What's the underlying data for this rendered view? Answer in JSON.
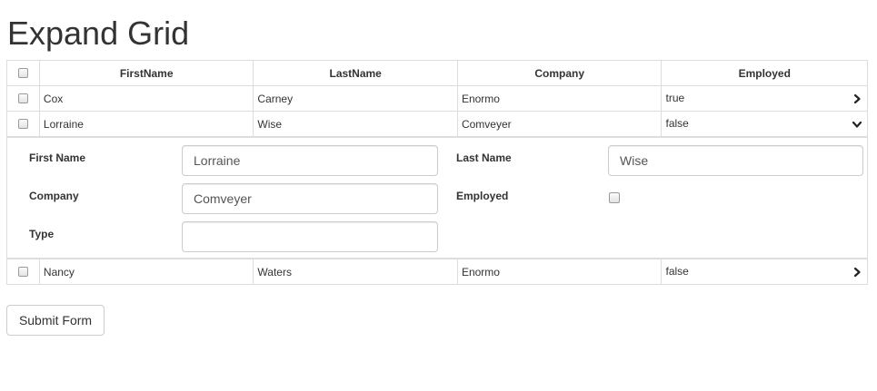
{
  "page": {
    "title": "Expand Grid"
  },
  "grid": {
    "columns": [
      "FirstName",
      "LastName",
      "Company",
      "Employed"
    ],
    "rows": [
      {
        "first": "Cox",
        "last": "Carney",
        "company": "Enormo",
        "employed": "true",
        "expander": "chevron-right-icon"
      },
      {
        "first": "Lorraine",
        "last": "Wise",
        "company": "Comveyer",
        "employed": "false",
        "expander": "chevron-down-icon"
      },
      {
        "first": "Nancy",
        "last": "Waters",
        "company": "Enormo",
        "employed": "false",
        "expander": "chevron-right-icon"
      }
    ],
    "detail": {
      "first_name_label": "First Name",
      "first_name_value": "Lorraine",
      "last_name_label": "Last Name",
      "last_name_value": "Wise",
      "company_label": "Company",
      "company_value": "Comveyer",
      "employed_label": "Employed",
      "employed_checked": false,
      "type_label": "Type",
      "type_value": ""
    }
  },
  "form": {
    "submit_label": "Submit Form"
  }
}
